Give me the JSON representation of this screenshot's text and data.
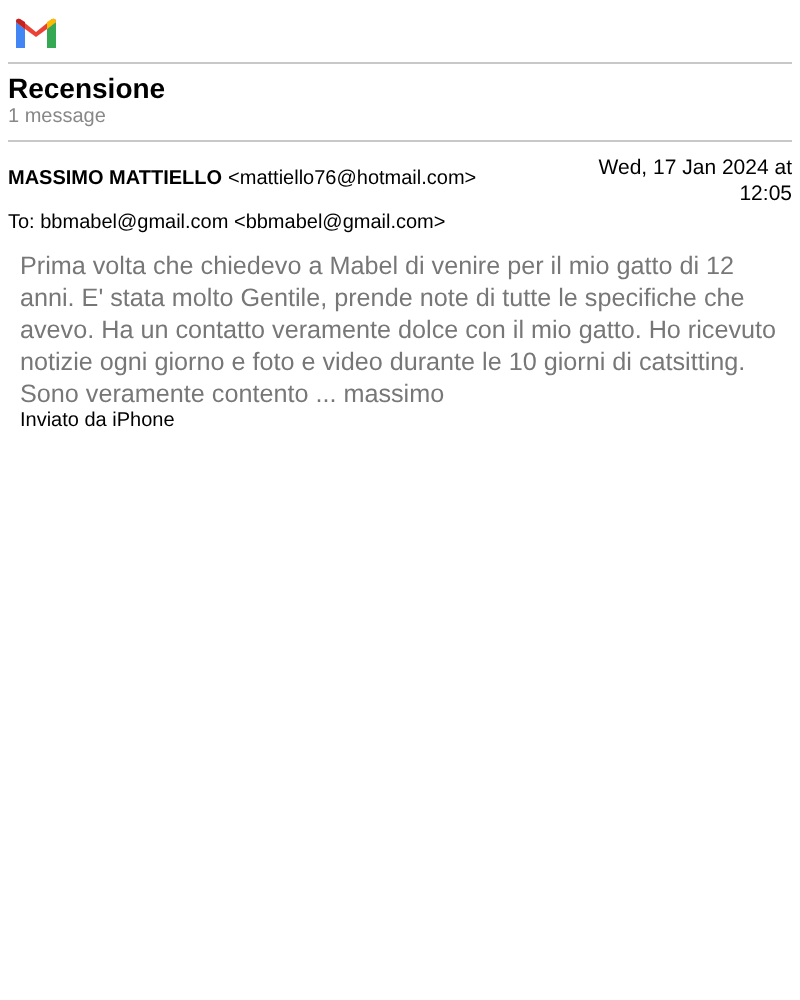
{
  "subject": "Recensione",
  "message_count": "1 message",
  "sender": {
    "name": "MASSIMO MATTIELLO",
    "email": "<mattiello76@hotmail.com>"
  },
  "date": "Wed, 17 Jan 2024 at 12:05",
  "to": "To: bbmabel@gmail.com <bbmabel@gmail.com>",
  "body": "Prima volta che chiedevo a Mabel di venire per il mio gatto di 12 anni. E' stata molto Gentile, prende note di tutte le specifiche che avevo. Ha un contatto veramente dolce con il mio gatto. Ho ricevuto notizie ogni giorno e foto e video durante le 10 giorni di catsitting. Sono veramente contento  ... massimo",
  "signature": "Inviato da iPhone"
}
